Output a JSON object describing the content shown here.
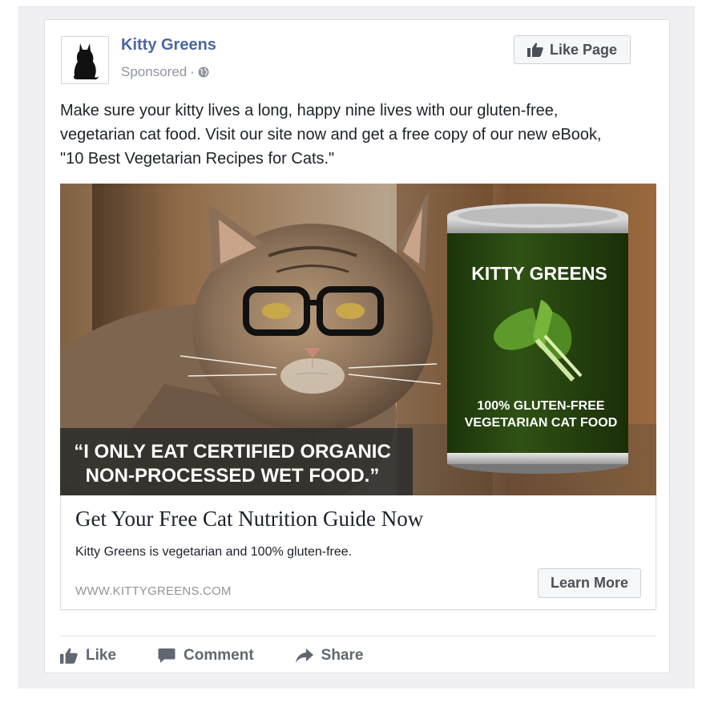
{
  "post": {
    "page_name": "Kitty Greens",
    "sponsored_label": "Sponsored",
    "meta_separator": "·",
    "like_page_label": "Like Page",
    "text": "Make sure your kitty lives a long, happy nine lives with our gluten-free,\nvegetarian cat food. Visit our site now and get a free copy of our new eBook,\n\"10 Best Vegetarian Recipes for Cats.\""
  },
  "ad_image": {
    "can_brand": "KITTY GREENS",
    "can_tagline_line1": "100% GLUTEN-FREE",
    "can_tagline_line2": "VEGETARIAN CAT FOOD",
    "quote_line1": "“I ONLY EAT CERTIFIED ORGANIC",
    "quote_line2": "NON-PROCESSED WET FOOD.”"
  },
  "link_preview": {
    "headline": "Get Your Free Cat Nutrition Guide Now",
    "description": "Kitty Greens is vegetarian and 100% gluten-free.",
    "domain": "WWW.KITTYGREENS.COM",
    "cta_label": "Learn More"
  },
  "actions": {
    "like_label": "Like",
    "comment_label": "Comment",
    "share_label": "Share"
  },
  "icons": {
    "thumbs_up": "thumbs-up-icon",
    "globe": "globe-icon",
    "comment": "comment-icon",
    "share": "share-icon"
  },
  "colors": {
    "page_name": "#4b67a1",
    "meta": "#90949c",
    "text": "#1d2129",
    "can_green": "#2b4a12",
    "action_text": "#616770"
  }
}
